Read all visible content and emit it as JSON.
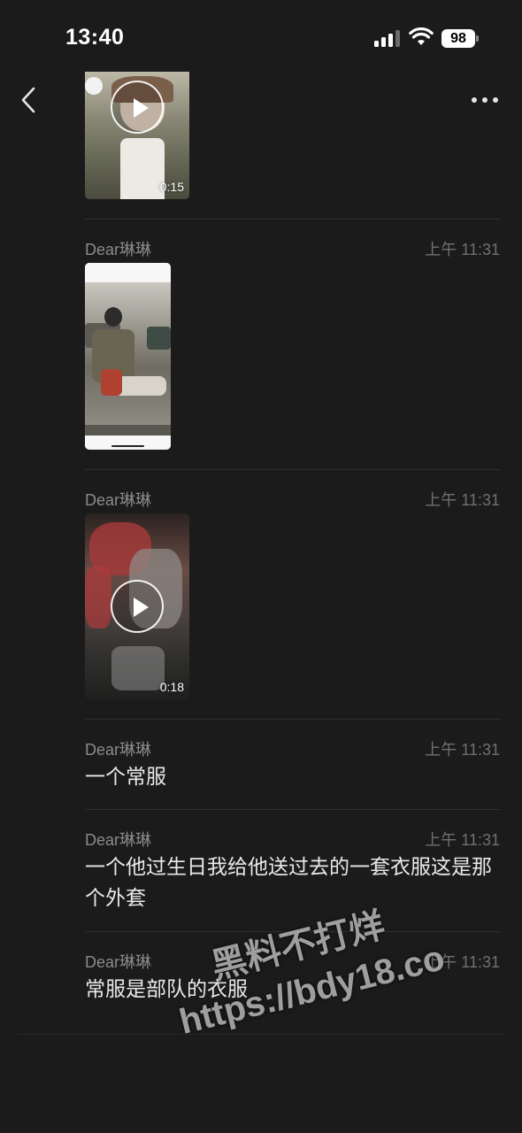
{
  "status_bar": {
    "time": "13:40",
    "battery": "98",
    "signal_icon": "cellular-signal-icon",
    "wifi_icon": "wifi-icon"
  },
  "nav": {
    "back_icon": "chevron-left-icon",
    "more_icon": "more-dots-icon"
  },
  "messages": [
    {
      "type": "video",
      "duration": "0:15"
    },
    {
      "type": "image",
      "sender": "Dear琳琳",
      "time": "上午 11:31"
    },
    {
      "type": "video",
      "sender": "Dear琳琳",
      "time": "上午 11:31",
      "duration": "0:18"
    },
    {
      "type": "text",
      "sender": "Dear琳琳",
      "time": "上午 11:31",
      "text": "一个常服"
    },
    {
      "type": "text",
      "sender": "Dear琳琳",
      "time": "上午 11:31",
      "text": "一个他过生日我给他送过去的一套衣服这是那个外套"
    },
    {
      "type": "text",
      "sender": "Dear琳琳",
      "time": "上午 11:31",
      "text": "常服是部队的衣服"
    }
  ],
  "watermark": {
    "line1": "黑料不打烊",
    "line2": "https://bdy18.co"
  },
  "colors": {
    "background": "#1b1b1b",
    "sender": "#8b8b8b",
    "timestamp": "#707070",
    "text": "#e9e9e9",
    "divider": "#2f2f2f"
  }
}
